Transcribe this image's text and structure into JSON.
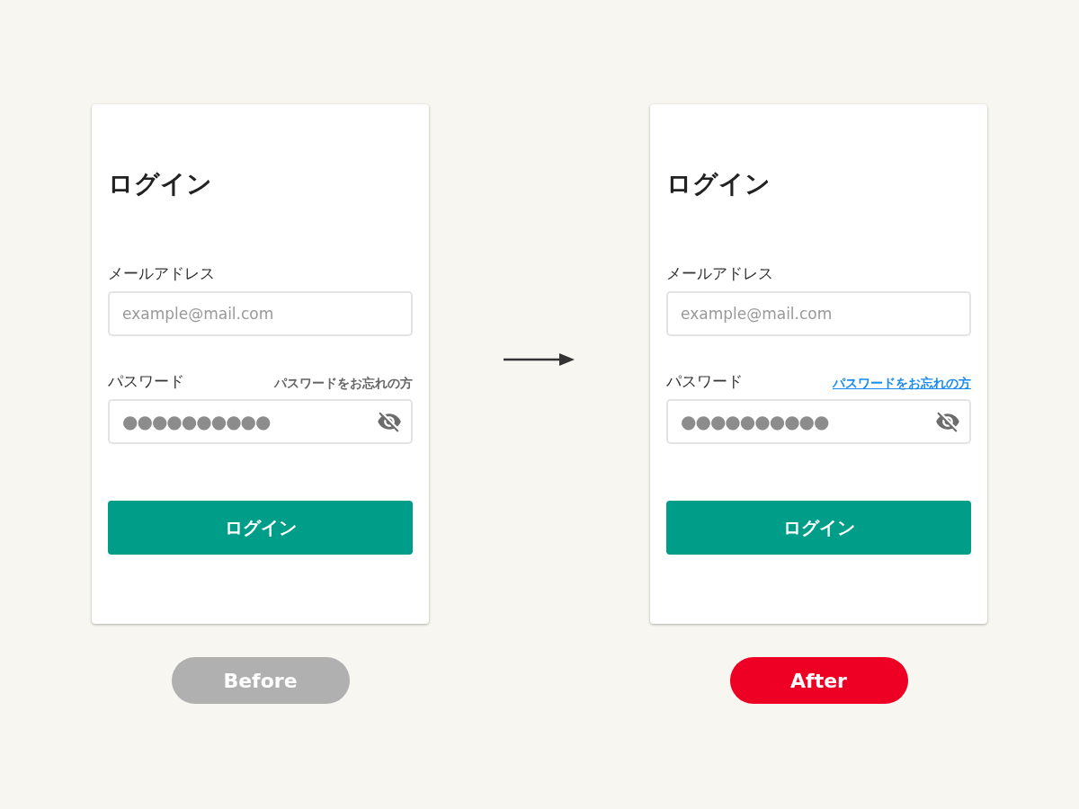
{
  "panels": [
    {
      "title": "ログイン",
      "email": {
        "label": "メールアドレス",
        "placeholder": "example@mail.com"
      },
      "password": {
        "label": "パスワード",
        "value": "●●●●●●●●●●",
        "forgot": {
          "text": "パスワードをお忘れの方",
          "kind": "plain"
        }
      },
      "submit": "ログイン",
      "badge": {
        "text": "Before",
        "color": "#b0b0b0"
      }
    },
    {
      "title": "ログイン",
      "email": {
        "label": "メールアドレス",
        "placeholder": "example@mail.com"
      },
      "password": {
        "label": "パスワード",
        "value": "●●●●●●●●●●",
        "forgot": {
          "text": "パスワードをお忘れの方",
          "kind": "link"
        }
      },
      "submit": "ログイン",
      "badge": {
        "text": "After",
        "color": "#ee0025"
      }
    }
  ]
}
